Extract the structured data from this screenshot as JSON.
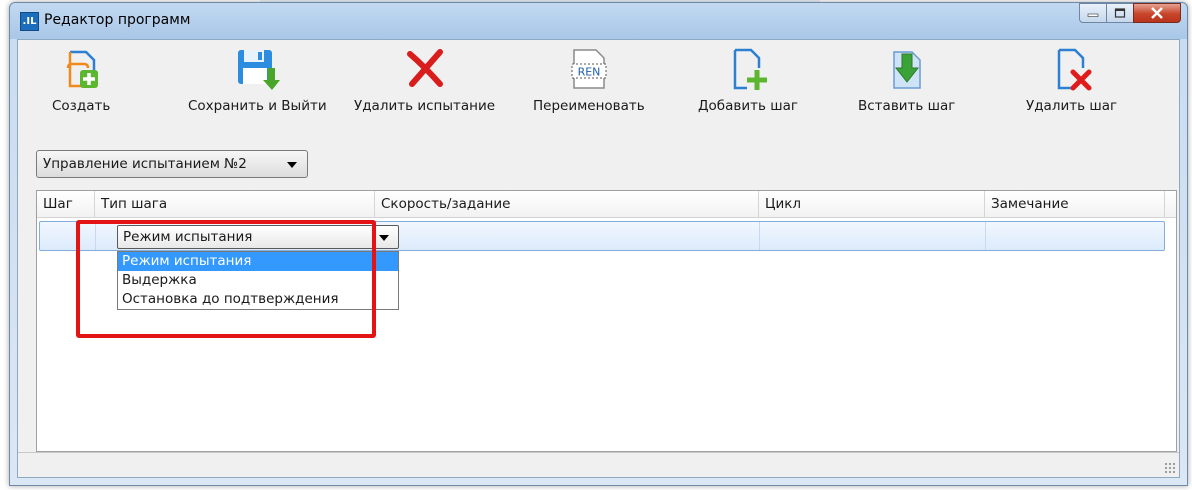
{
  "window": {
    "title": "Редактор программ",
    "app_icon_text": ".IL"
  },
  "toolbar": {
    "items": [
      {
        "label": "Создать",
        "icon": "create-document-icon"
      },
      {
        "label": "Сохранить и Выйти",
        "icon": "save-exit-icon"
      },
      {
        "label": "Удалить испытание",
        "icon": "delete-cross-icon"
      },
      {
        "label": "Переименовать",
        "icon": "rename-icon"
      },
      {
        "label": "Добавить шаг",
        "icon": "add-step-icon"
      },
      {
        "label": "Вставить шаг",
        "icon": "insert-step-icon"
      },
      {
        "label": "Удалить шаг",
        "icon": "delete-step-icon"
      }
    ],
    "rename_icon_text": "REN"
  },
  "test_select": {
    "value": "Управление испытанием №2"
  },
  "table": {
    "columns": [
      "Шаг",
      "Тип шага",
      "Скорость/задание",
      "Цикл",
      "Замечание"
    ],
    "row": {
      "step_type": "Режим испытания"
    }
  },
  "dropdown": {
    "options": [
      "Режим испытания",
      "Выдержка",
      "Остановка до подтверждения"
    ],
    "selected_index": 0
  },
  "colors": {
    "highlight": "#e51414",
    "selection": "#3399ff"
  }
}
